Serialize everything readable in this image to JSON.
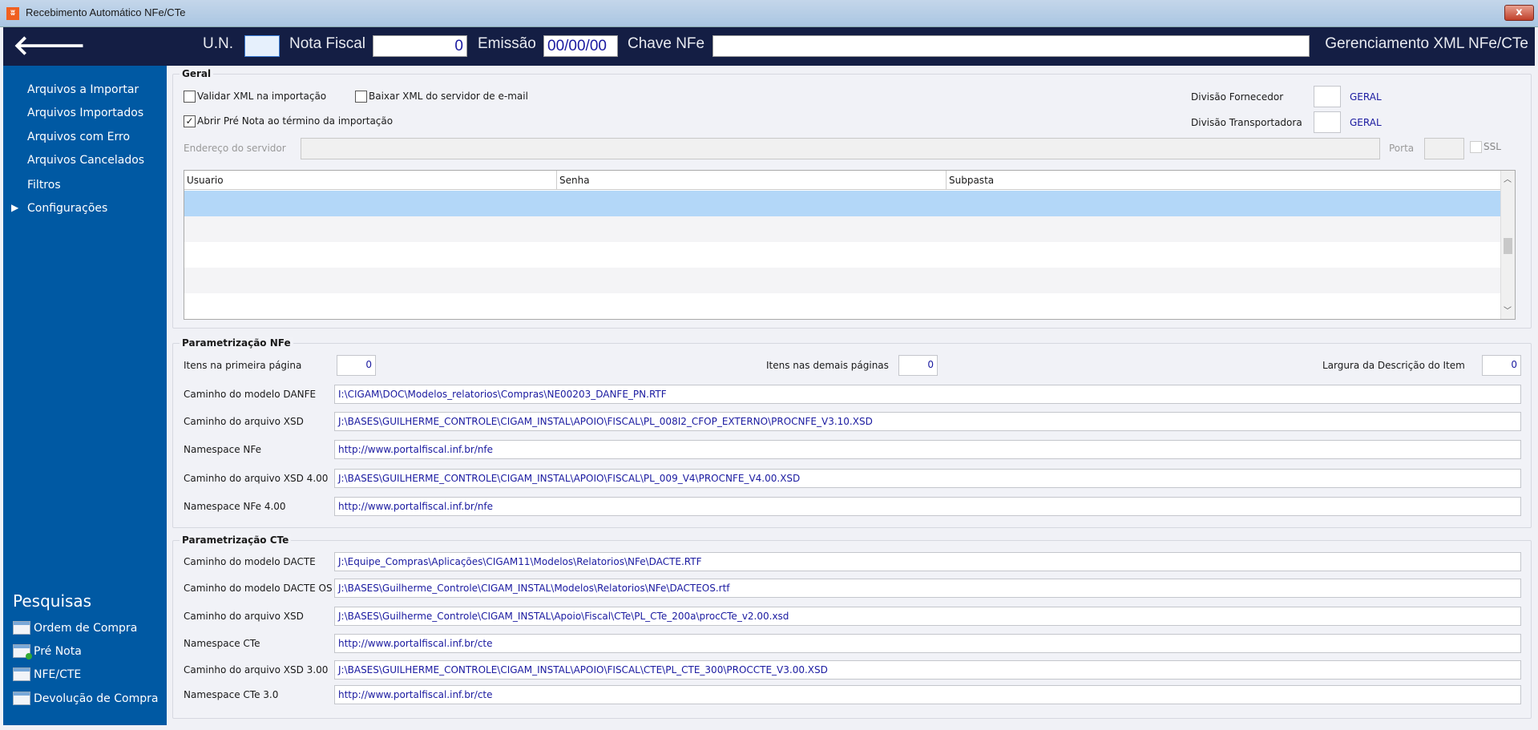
{
  "window": {
    "title": "Recebimento Automático NFe/CTe",
    "close": "x"
  },
  "header": {
    "un_label": "U.N.",
    "un_value": "",
    "nota_label": "Nota Fiscal",
    "nota_value": "0",
    "emissao_label": "Emissão",
    "emissao_value": "00/00/00",
    "chave_label": "Chave NFe",
    "chave_value": "",
    "module_title": "Gerenciamento XML NFe/CTe"
  },
  "sidebar": {
    "items": [
      {
        "label": "Arquivos a Importar"
      },
      {
        "label": "Arquivos Importados"
      },
      {
        "label": "Arquivos com Erro"
      },
      {
        "label": "Arquivos Cancelados"
      },
      {
        "label": "Filtros"
      },
      {
        "label": "Configurações",
        "arrow": "▶"
      }
    ],
    "pesquisas_title": "Pesquisas",
    "pesquisas": [
      {
        "label": "Ordem de Compra"
      },
      {
        "label": "Pré Nota"
      },
      {
        "label": "NFE/CTE"
      },
      {
        "label": "Devolução de Compra"
      }
    ]
  },
  "geral": {
    "title": "Geral",
    "validar_label": "Validar XML na importação",
    "validar_checked": false,
    "baixar_label": "Baixar XML do servidor de e-mail",
    "baixar_checked": false,
    "abrir_label": "Abrir Pré Nota ao término da importação",
    "abrir_checked": true,
    "div_fornecedor_label": "Divisão Fornecedor",
    "div_fornecedor_value": "",
    "div_fornecedor_desc": "GERAL",
    "div_transp_label": "Divisão Transportadora",
    "div_transp_value": "",
    "div_transp_desc": "GERAL",
    "endereco_label": "Endereço do servidor",
    "endereco_value": "",
    "porta_label": "Porta",
    "porta_value": "",
    "ssl_label": "SSL",
    "grid_columns": [
      "Usuario",
      "Senha",
      "Subpasta"
    ]
  },
  "nfe": {
    "title": "Parametrização NFe",
    "itens_primeira_label": "Itens na primeira página",
    "itens_primeira_value": "0",
    "itens_demais_label": "Itens nas demais páginas",
    "itens_demais_value": "0",
    "largura_label": "Largura da Descrição do Item",
    "largura_value": "0",
    "rows": [
      {
        "label": "Caminho do modelo DANFE",
        "value": "I:\\CIGAM\\DOC\\Modelos_relatorios\\Compras\\NE00203_DANFE_PN.RTF"
      },
      {
        "label": "Caminho do arquivo XSD",
        "value": "J:\\BASES\\GUILHERME_CONTROLE\\CIGAM_INSTAL\\APOIO\\FISCAL\\PL_008I2_CFOP_EXTERNO\\PROCNFE_V3.10.XSD"
      },
      {
        "label": "Namespace NFe",
        "value": "http://www.portalfiscal.inf.br/nfe"
      },
      {
        "label": "Caminho do arquivo XSD 4.00",
        "value": "J:\\BASES\\GUILHERME_CONTROLE\\CIGAM_INSTAL\\APOIO\\FISCAL\\PL_009_V4\\PROCNFE_V4.00.XSD"
      },
      {
        "label": "Namespace NFe 4.00",
        "value": "http://www.portalfiscal.inf.br/nfe"
      }
    ]
  },
  "cte": {
    "title": "Parametrização CTe",
    "rows": [
      {
        "label": "Caminho do modelo DACTE",
        "value": "J:\\Equipe_Compras\\Aplicações\\CIGAM11\\Modelos\\Relatorios\\NFe\\DACTE.RTF"
      },
      {
        "label": "Caminho do modelo DACTE OS",
        "value": "J:\\BASES\\Guilherme_Controle\\CIGAM_INSTAL\\Modelos\\Relatorios\\NFe\\DACTEOS.rtf"
      },
      {
        "label": "Caminho do arquivo XSD",
        "value": "J:\\BASES\\Guilherme_Controle\\CIGAM_INSTAL\\Apoio\\Fiscal\\CTe\\PL_CTe_200a\\procCTe_v2.00.xsd"
      },
      {
        "label": "Namespace CTe",
        "value": "http://www.portalfiscal.inf.br/cte"
      },
      {
        "label": "Caminho do arquivo XSD 3.00",
        "value": "J:\\BASES\\GUILHERME_CONTROLE\\CIGAM_INSTAL\\APOIO\\FISCAL\\CTE\\PL_CTE_300\\PROCCTE_V3.00.XSD"
      },
      {
        "label": "Namespace CTe 3.0",
        "value": "http://www.portalfiscal.inf.br/cte"
      }
    ]
  },
  "colors": {
    "header": "#141e44",
    "sidebar": "#0059a3",
    "selected_row": "#b3d7f8",
    "value_text": "#1a1aa0"
  }
}
